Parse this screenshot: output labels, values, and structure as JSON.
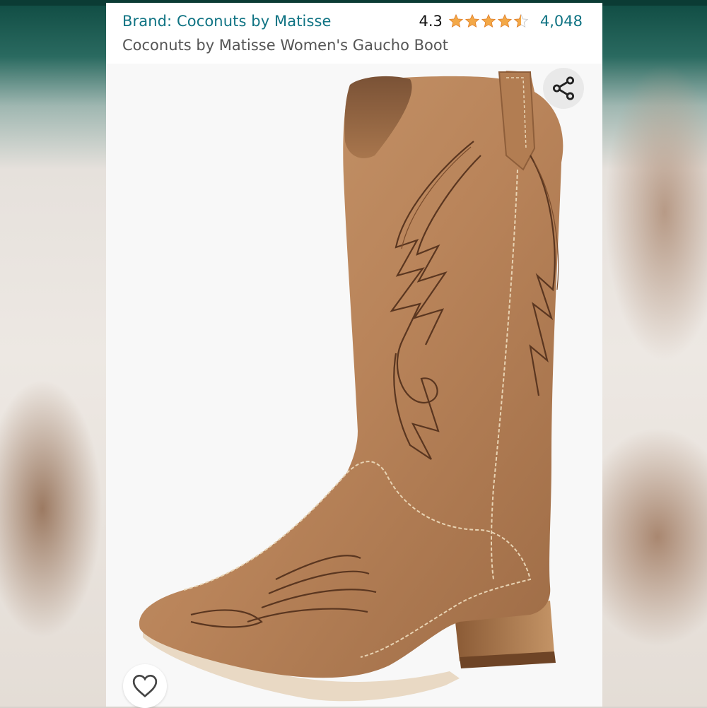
{
  "header": {
    "brand_link": "Brand: Coconuts by Matisse",
    "rating_value": "4.3",
    "rating_fraction": 0.86,
    "review_count": "4,048",
    "product_title": "Coconuts by Matisse Women's Gaucho Boot"
  },
  "icons": {
    "share": "share-icon",
    "wishlist": "heart-icon",
    "star": "star-icon"
  },
  "colors": {
    "link": "#0f7383",
    "star": "#f3a847",
    "boot": "#b9845a"
  }
}
